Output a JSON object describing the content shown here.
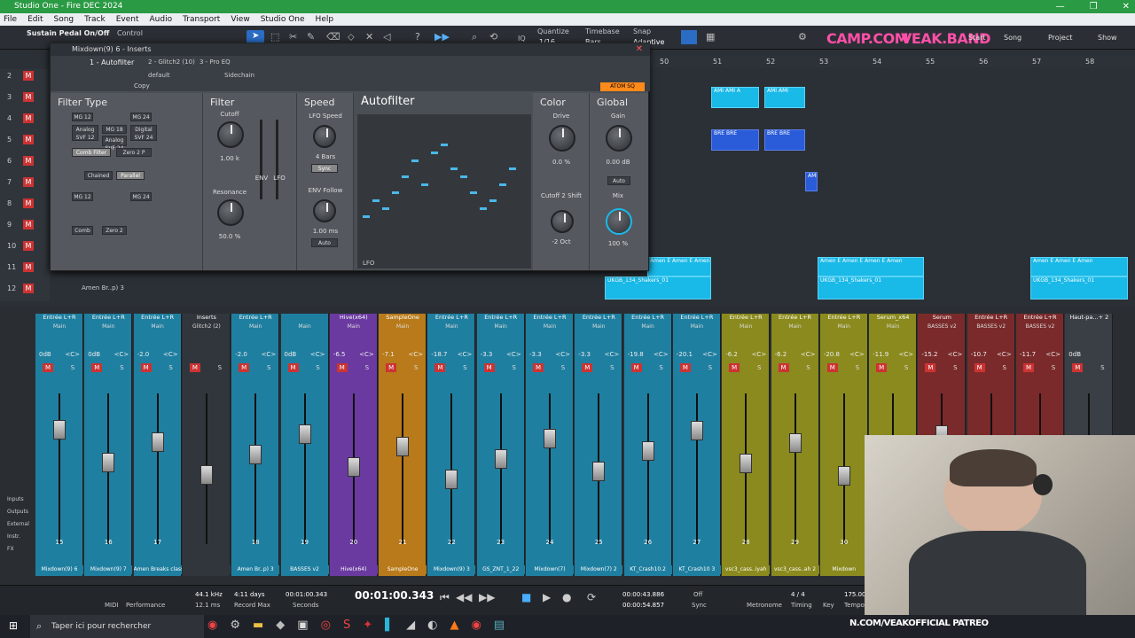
{
  "window": {
    "title": "Studio One - Fire DEC 2024",
    "buttons": [
      "—",
      "❐",
      "✕"
    ]
  },
  "menu": [
    "File",
    "Edit",
    "Song",
    "Track",
    "Event",
    "Audio",
    "Transport",
    "View",
    "Studio One",
    "Help"
  ],
  "toolbar": {
    "left_text": "Sustain Pedal On/Off",
    "control_label": "Control",
    "quantize_label": "Quantize",
    "quantize_value": "1/16",
    "timebase_label": "Timebase",
    "timebase_value": "Bars",
    "snap_label": "Snap",
    "snap_value": "Adaptive",
    "brand1": "CAMP.COM",
    "brand2": "VEAK.BAND",
    "start": "Start",
    "song": "Song",
    "project": "Project",
    "show": "Show"
  },
  "plugin": {
    "title": "Mixdown(9) 6 - Inserts",
    "preset_track": "1 - Autofilter",
    "slot2": "2 - Glitch2 (10)",
    "slot3": "3 - Pro EQ",
    "preset_name": "default",
    "sidechain": "Sidechain",
    "copy": "Copy",
    "atom": "ATOM SQ",
    "filter_type_title": "Filter Type",
    "filter_title": "Filter",
    "speed_title": "Speed",
    "autofilter_title": "Autofilter",
    "color_title": "Color",
    "global_title": "Global",
    "type_buttons_a": [
      "MG 12",
      "MG 24",
      "Analog SVF 12",
      "MG 18",
      "Digital SVF 24",
      "Analog SVF 24",
      "Comb Filter",
      "Zero 2 P"
    ],
    "chained": "Chained",
    "parallel": "Parallel",
    "cutoff_label": "Cutoff",
    "cutoff_value": "1.00 k",
    "resonance_label": "Resonance",
    "resonance_value": "50.0 %",
    "env": "ENV",
    "lfo": "LFO",
    "lfo_speed_label": "LFO Speed",
    "lfo_speed_value": "4 Bars",
    "sync": "Sync",
    "env_follow_label": "ENV Follow",
    "env_follow_value": "1.00 ms",
    "auto": "Auto",
    "drive_label": "Drive",
    "drive_value": "0.0 %",
    "cutoff2_label": "Cutoff 2 Shift",
    "cutoff2_value": "-2 Oct",
    "gain_label": "Gain",
    "gain_value": "0.00 dB",
    "mix_label": "Mix",
    "mix_value": "100 %",
    "lfo_shape_label": "LFO"
  },
  "arrange": {
    "ruler": [
      "50",
      "51",
      "52",
      "53",
      "54",
      "55",
      "56",
      "57",
      "58"
    ],
    "tracks": [
      {
        "num": "2",
        "name": ""
      },
      {
        "num": "3",
        "name": ""
      },
      {
        "num": "4",
        "name": ""
      },
      {
        "num": "5",
        "name": ""
      },
      {
        "num": "6",
        "name": ""
      },
      {
        "num": "7",
        "name": ""
      },
      {
        "num": "8",
        "name": ""
      },
      {
        "num": "9",
        "name": ""
      },
      {
        "num": "10",
        "name": ""
      },
      {
        "num": "11",
        "name": ""
      },
      {
        "num": "12",
        "name": "Amen Br..p) 3"
      }
    ],
    "clips": [
      "AMI AMI A",
      "AMI AMI",
      "BRE BRE",
      "BRE BRE",
      "AMI",
      "Amen E Amen E Amen",
      "UKGB_134_Shakers_01",
      "Amen E Amen E Amen E Amen",
      "UKGB_134_Shakers_01",
      "Amen E Amen E Amen",
      "UKGB_134_Shakers_01"
    ]
  },
  "mixer": {
    "channels": [
      {
        "name": "Entrée L+R",
        "sub": "Main",
        "vol": "0dB",
        "pan": "<C>",
        "num": "15",
        "bottom": "Mixdown(9) 6",
        "color": "#1f7fa0"
      },
      {
        "name": "Entrée L+R",
        "sub": "Main",
        "vol": "0dB",
        "pan": "<C>",
        "num": "16",
        "bottom": "Mixdown(9) 7",
        "color": "#1f7fa0"
      },
      {
        "name": "Entrée L+R",
        "sub": "Main",
        "vol": "-2.0",
        "pan": "<C>",
        "num": "17",
        "bottom": "Amen Breaks classic_175_DE..oop)",
        "color": "#1f7fa0"
      },
      {
        "name": "Inserts",
        "sub": "Glitch2 (2)",
        "vol": "",
        "pan": "",
        "num": "",
        "bottom": "",
        "color": "#31363c"
      },
      {
        "name": "Entrée L+R",
        "sub": "Main",
        "vol": "-2.0",
        "pan": "<C>",
        "num": "18",
        "bottom": "Amen Br..p) 3",
        "color": "#1f7fa0"
      },
      {
        "name": "",
        "sub": "Main",
        "vol": "0dB",
        "pan": "<C>",
        "num": "19",
        "bottom": "BASSES v2",
        "color": "#1f7fa0"
      },
      {
        "name": "Hive(x64)",
        "sub": "Main",
        "vol": "-6.5",
        "pan": "<C>",
        "num": "20",
        "bottom": "Hive(x64)",
        "color": "#6a3aa0"
      },
      {
        "name": "SampleOne",
        "sub": "Main",
        "vol": "-7.1",
        "pan": "<C>",
        "num": "21",
        "bottom": "SampleOne",
        "color": "#b87a1a"
      },
      {
        "name": "Entrée L+R",
        "sub": "Main",
        "vol": "-18.7",
        "pan": "<C>",
        "num": "22",
        "bottom": "Mixdown(9) 3",
        "color": "#1f7fa0"
      },
      {
        "name": "Entrée L+R",
        "sub": "Main",
        "vol": "-3.3",
        "pan": "<C>",
        "num": "23",
        "bottom": "GS_ZNT_1_22",
        "color": "#1f7fa0"
      },
      {
        "name": "Entrée L+R",
        "sub": "Main",
        "vol": "-3.3",
        "pan": "<C>",
        "num": "24",
        "bottom": "Mixdown(7)",
        "color": "#1f7fa0"
      },
      {
        "name": "Entrée L+R",
        "sub": "Main",
        "vol": "-3.3",
        "pan": "<C>",
        "num": "25",
        "bottom": "Mixdown(7) 2",
        "color": "#1f7fa0"
      },
      {
        "name": "Entrée L+R",
        "sub": "Main",
        "vol": "-19.8",
        "pan": "<C>",
        "num": "26",
        "bottom": "KT_Crash10.2",
        "color": "#1f7fa0"
      },
      {
        "name": "Entrée L+R",
        "sub": "Main",
        "vol": "-20.1",
        "pan": "<C>",
        "num": "27",
        "bottom": "KT_Crash10 3",
        "color": "#1f7fa0"
      },
      {
        "name": "Entrée L+R",
        "sub": "Main",
        "vol": "-6.2",
        "pan": "<C>",
        "num": "28",
        "bottom": "vsc3_cass..iyah",
        "color": "#8a8a1e"
      },
      {
        "name": "Entrée L+R",
        "sub": "Main",
        "vol": "-6.2",
        "pan": "<C>",
        "num": "29",
        "bottom": "vsc3_cass..ah 2",
        "color": "#8a8a1e"
      },
      {
        "name": "Entrée L+R",
        "sub": "Main",
        "vol": "-20.8",
        "pan": "<C>",
        "num": "30",
        "bottom": "Mixdown",
        "color": "#8a8a1e"
      },
      {
        "name": "Serum_x64",
        "sub": "Main",
        "vol": "-11.9",
        "pan": "<C>",
        "num": "",
        "bottom": "",
        "color": "#8a8a1e"
      },
      {
        "name": "Serum",
        "sub": "BASSES v2",
        "vol": "-15.2",
        "pan": "<C>",
        "num": "",
        "bottom": "",
        "color": "#7a2a2a"
      },
      {
        "name": "Entrée L+R",
        "sub": "BASSES v2",
        "vol": "-10.7",
        "pan": "<C>",
        "num": "",
        "bottom": "",
        "color": "#7a2a2a"
      },
      {
        "name": "Entrée L+R",
        "sub": "BASSES v2",
        "vol": "-11.7",
        "pan": "<C>",
        "num": "",
        "bottom": "",
        "color": "#7a2a2a"
      },
      {
        "name": "Haut-pa...+ 2",
        "sub": "",
        "vol": "0dB",
        "pan": "",
        "num": "",
        "bottom": "",
        "color": "#3a3f45"
      }
    ],
    "side_labels": [
      "Inputs",
      "Outputs",
      "External",
      "Instr.",
      "FX"
    ]
  },
  "transport": {
    "midi": "MIDI",
    "performance": "Performance",
    "samplerate": "44.1 kHz",
    "latency": "12.1 ms",
    "record_len": "4:11 days",
    "record_label": "Record Max",
    "time_small": "00:01:00.343",
    "seconds": "Seconds",
    "time_big": "00:01:00.343",
    "loop_start": "00:00:43.886",
    "loop_end": "00:00:54.857",
    "off": "Off",
    "sync": "Sync",
    "metronome": "Metronome",
    "timesig": "4 / 4",
    "timing": "Timing",
    "key": "Key",
    "tempo": "175.00",
    "tempo_label": "Tempo"
  },
  "taskbar": {
    "search_placeholder": "Taper ici pour rechercher"
  },
  "overlay": {
    "patreon": "N.COM/VEAKOFFICIAL PATREO"
  }
}
